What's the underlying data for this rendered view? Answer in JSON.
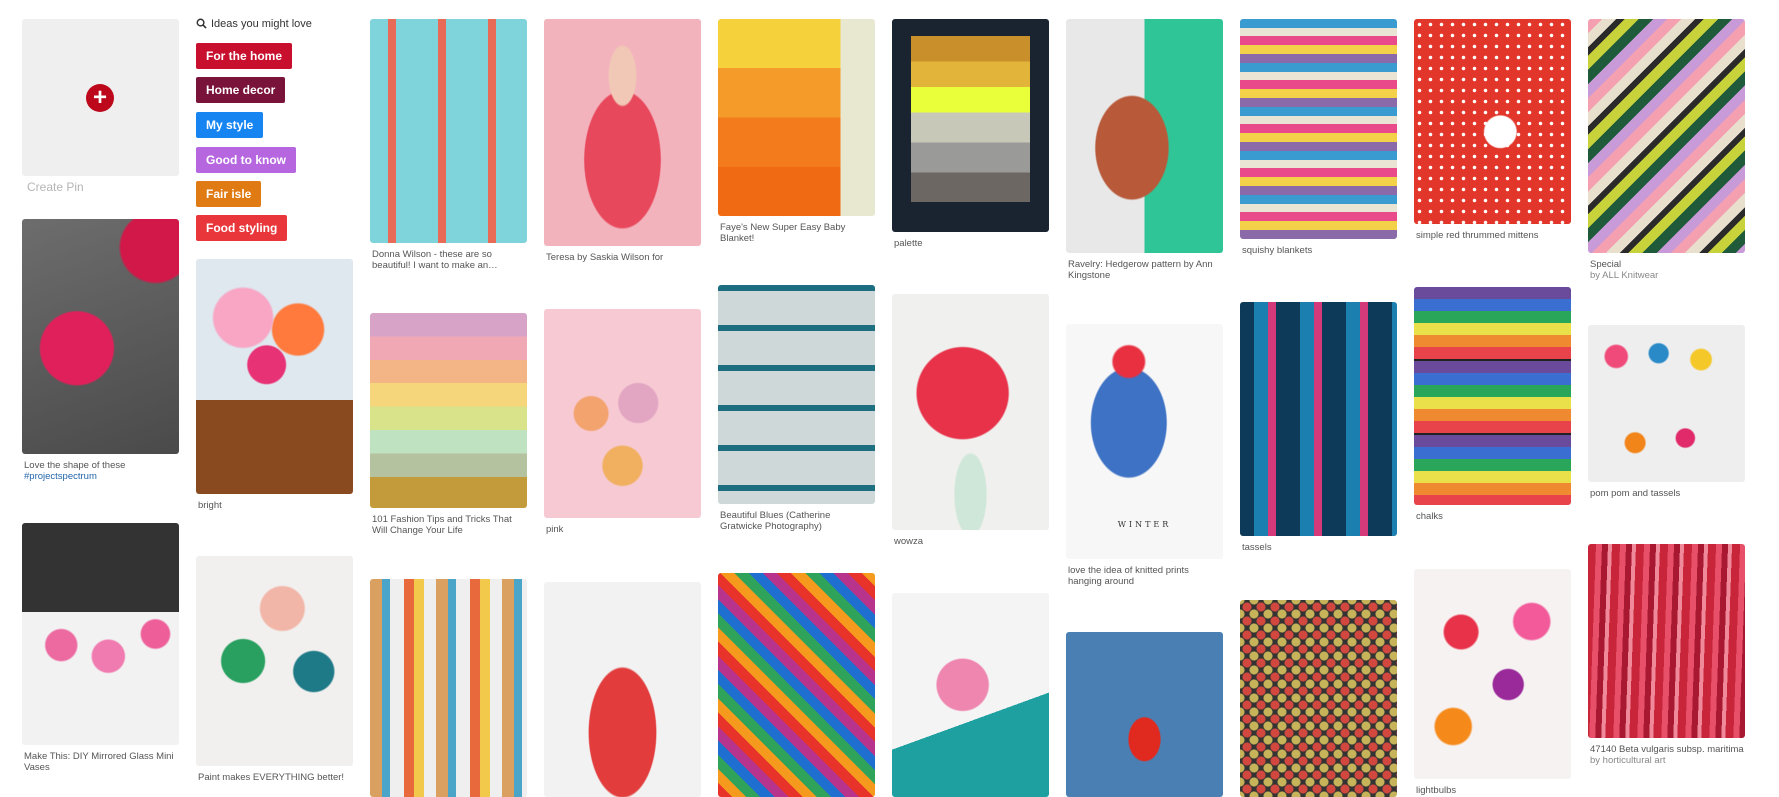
{
  "create_pin": {
    "label": "Create Pin",
    "icon": "plus-circle-icon"
  },
  "ideas": {
    "title": "Ideas you might love",
    "icon": "search-icon",
    "chips": [
      {
        "label": "For the home",
        "color": "#c8102e"
      },
      {
        "label": "Home decor",
        "color": "#7a1339"
      },
      {
        "label": "My style",
        "color": "#1685f2"
      },
      {
        "label": "Good to know",
        "color": "#b667e0"
      },
      {
        "label": "Fair isle",
        "color": "#e07a13"
      },
      {
        "label": "Food styling",
        "color": "#e8363a"
      }
    ]
  },
  "pins": [
    {
      "caption": "Love the shape of these",
      "tag": "#projectspectrum"
    },
    {
      "caption": "Make This: DIY Mirrored Glass Mini Vases"
    },
    {
      "caption": "bright"
    },
    {
      "caption": "Paint makes EVERYTHING better!"
    },
    {
      "caption": "Donna Wilson - these are so beautiful! I want to make an…"
    },
    {
      "caption": "101 Fashion Tips and Tricks That Will Change Your Life"
    },
    {
      "caption": ""
    },
    {
      "caption": "Teresa by Saskia Wilson for"
    },
    {
      "caption": "pink"
    },
    {
      "caption": ""
    },
    {
      "caption": "Faye's New Super Easy Baby Blanket!"
    },
    {
      "caption": "Beautiful Blues (Catherine Gratwicke Photography)"
    },
    {
      "caption": ""
    },
    {
      "caption": "palette"
    },
    {
      "caption": "wowza"
    },
    {
      "caption": ""
    },
    {
      "caption": "Ravelry: Hedgerow pattern by Ann Kingstone"
    },
    {
      "caption": "love the idea of knitted prints hanging around",
      "image_text": "WINTER"
    },
    {
      "caption": ""
    },
    {
      "caption": "squishy blankets"
    },
    {
      "caption": "tassels"
    },
    {
      "caption": ""
    },
    {
      "caption": "simple red thrummed mittens"
    },
    {
      "caption": "chalks"
    },
    {
      "caption": "lightbulbs"
    },
    {
      "caption": "Special",
      "sub": "by ALL Knitwear"
    },
    {
      "caption": "pom pom and tassels"
    },
    {
      "caption": "47140 Beta vulgaris subsp. maritima",
      "sub": "by horticultural art"
    }
  ]
}
